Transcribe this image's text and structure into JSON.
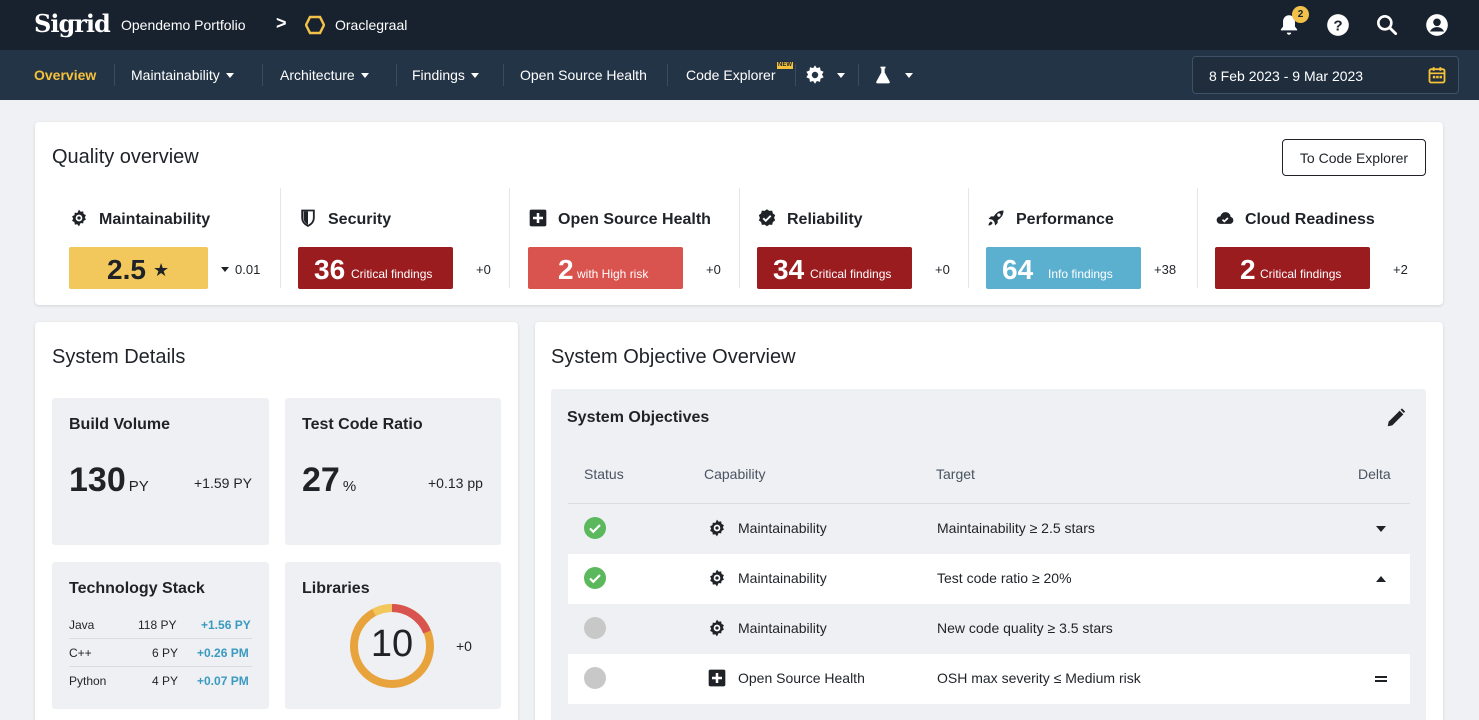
{
  "topbar": {
    "logo": "Sigrid",
    "portfolio": "Opendemo Portfolio",
    "separator": ">",
    "system": "Oraclegraal",
    "notifications_count": "2",
    "icons": [
      "bell-icon",
      "help-icon",
      "search-icon",
      "account-icon"
    ]
  },
  "nav": {
    "items": [
      {
        "label": "Overview",
        "active": true
      },
      {
        "label": "Maintainability",
        "dropdown": true
      },
      {
        "label": "Architecture",
        "dropdown": true
      },
      {
        "label": "Findings",
        "dropdown": true
      },
      {
        "label": "Open Source Health"
      },
      {
        "label": "Code Explorer",
        "badge": "NEW"
      }
    ],
    "date_range": "8 Feb 2023 - 9 Mar 2023"
  },
  "quality_overview": {
    "title": "Quality overview",
    "button": "To Code Explorer",
    "metrics": [
      {
        "name": "Maintainability",
        "icon": "maintainability-icon",
        "value": "2.5",
        "suffix": "★",
        "sub": "",
        "delta": "0.01",
        "delta_dir": "down",
        "color": "#f2c75c"
      },
      {
        "name": "Security",
        "icon": "shield-icon",
        "value": "36",
        "sub": "Critical findings",
        "delta": "+0",
        "color": "#9b1c1f"
      },
      {
        "name": "Open Source Health",
        "icon": "plus-square-icon",
        "value": "2",
        "sub": "with High risk",
        "delta": "+0",
        "color": "#d9534f"
      },
      {
        "name": "Reliability",
        "icon": "badge-check-icon",
        "value": "34",
        "sub": "Critical findings",
        "delta": "+0",
        "color": "#9b1c1f"
      },
      {
        "name": "Performance",
        "icon": "rocket-icon",
        "value": "64",
        "sub": "Info findings",
        "delta": "+38",
        "color": "#5bb0d0"
      },
      {
        "name": "Cloud Readiness",
        "icon": "cloud-icon",
        "value": "2",
        "sub": "Critical findings",
        "delta": "+2",
        "color": "#9b1c1f"
      }
    ]
  },
  "system_details": {
    "title": "System Details",
    "build_volume": {
      "title": "Build Volume",
      "value": "130",
      "unit": "PY",
      "delta": "+1.59 PY"
    },
    "test_code_ratio": {
      "title": "Test Code Ratio",
      "value": "27",
      "unit": "%",
      "delta": "+0.13 pp"
    },
    "technology_stack": {
      "title": "Technology Stack",
      "rows": [
        {
          "lang": "Java",
          "py": "118 PY",
          "delta": "+1.56 PY"
        },
        {
          "lang": "C++",
          "py": "6 PY",
          "delta": "+0.26 PM"
        },
        {
          "lang": "Python",
          "py": "4 PY",
          "delta": "+0.07 PM"
        }
      ]
    },
    "libraries": {
      "title": "Libraries",
      "value": "10",
      "delta": "+0"
    }
  },
  "system_objectives": {
    "title": "System Objective Overview",
    "panel_title": "System Objectives",
    "headers": {
      "status": "Status",
      "capability": "Capability",
      "target": "Target",
      "delta": "Delta"
    },
    "rows": [
      {
        "status": "met",
        "capability": "Maintainability",
        "cap_icon": "maintainability-icon",
        "target": "Maintainability ≥ 2.5 stars",
        "delta": "down"
      },
      {
        "status": "met",
        "capability": "Maintainability",
        "cap_icon": "maintainability-icon",
        "target": "Test code ratio ≥ 20%",
        "delta": "up"
      },
      {
        "status": "unknown",
        "capability": "Maintainability",
        "cap_icon": "maintainability-icon",
        "target": "New code quality ≥ 3.5 stars",
        "delta": "none"
      },
      {
        "status": "unknown",
        "capability": "Open Source Health",
        "cap_icon": "plus-square-icon",
        "target": "OSH max severity ≤ Medium risk",
        "delta": "equal"
      }
    ]
  },
  "colors": {
    "topbar": "#18212e",
    "navbar": "#243447",
    "accent": "#f5c23a",
    "met": "#5cb85c",
    "unknown": "#c8c8c8"
  }
}
